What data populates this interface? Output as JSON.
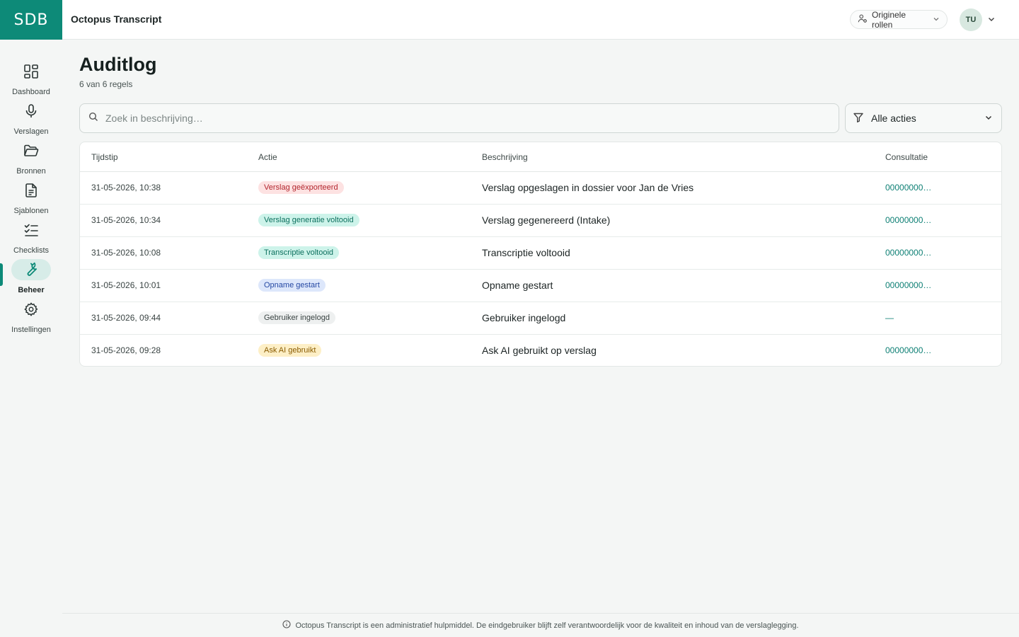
{
  "header": {
    "logo_text": "SDB",
    "app_title": "Octopus Transcript",
    "role_button_label": "Originele rollen",
    "avatar_initials": "TU"
  },
  "sidebar": {
    "items": [
      {
        "label": "Dashboard",
        "icon": "dashboard-grid-icon"
      },
      {
        "label": "Verslagen",
        "icon": "microphone-icon"
      },
      {
        "label": "Bronnen",
        "icon": "folder-open-icon"
      },
      {
        "label": "Sjablonen",
        "icon": "document-icon"
      },
      {
        "label": "Checklists",
        "icon": "checklist-icon"
      },
      {
        "label": "Beheer",
        "icon": "wrench-icon",
        "active": true
      },
      {
        "label": "Instellingen",
        "icon": "gear-icon"
      }
    ]
  },
  "page": {
    "title": "Auditlog",
    "subtitle": "6 van 6 regels"
  },
  "search": {
    "placeholder": "Zoek in beschrijving…"
  },
  "filter": {
    "selected": "Alle acties"
  },
  "table": {
    "columns": [
      "Tijdstip",
      "Actie",
      "Beschrijving",
      "Consultatie"
    ],
    "rows": [
      {
        "time": "31-05-2026, 10:38",
        "action": "Verslag geëxporteerd",
        "badge_color": "#fde2e2",
        "description": "Verslag opgeslagen in dossier voor Jan de Vries",
        "consultation": "00000000…"
      },
      {
        "time": "31-05-2026, 10:34",
        "action": "Verslag generatie voltooid",
        "badge_color": "#cdf3ea",
        "description": "Verslag gegenereerd (Intake)",
        "consultation": "00000000…"
      },
      {
        "time": "31-05-2026, 10:08",
        "action": "Transcriptie voltooid",
        "badge_color": "#cdf3ea",
        "description": "Transcriptie voltooid",
        "consultation": "00000000…"
      },
      {
        "time": "31-05-2026, 10:01",
        "action": "Opname gestart",
        "badge_color": "#dde7fb",
        "description": "Opname gestart",
        "consultation": "00000000…"
      },
      {
        "time": "31-05-2026, 09:44",
        "action": "Gebruiker ingelogd",
        "badge_color": "#eef0f0",
        "description": "Gebruiker ingelogd",
        "consultation": "—"
      },
      {
        "time": "31-05-2026, 09:28",
        "action": "Ask AI gebruikt",
        "badge_color": "#fdefc6",
        "description": "Ask AI gebruikt op verslag",
        "consultation": "00000000…"
      }
    ]
  },
  "footer": {
    "disclaimer": "Octopus Transcript is een administratief hulpmiddel. De eindgebruiker blijft zelf verantwoordelijk voor de kwaliteit en inhoud van de verslaglegging."
  },
  "colors": {
    "brand": "#0d8a78",
    "link": "#0d7f74",
    "background": "#f4f6f5"
  }
}
